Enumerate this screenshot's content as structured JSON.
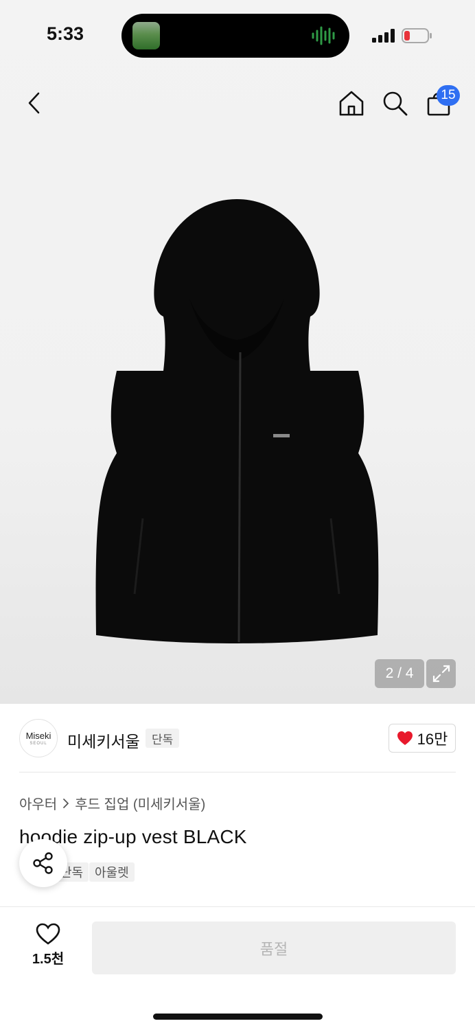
{
  "status_bar": {
    "time": "5:33"
  },
  "nav": {
    "cart_count": "15"
  },
  "gallery": {
    "counter": "2 / 4"
  },
  "brand": {
    "logo_text": "Miseki",
    "logo_subtext": "SEOUL",
    "name": "미세키서울",
    "tag": "단독",
    "likes": "16만"
  },
  "breadcrumb": {
    "category": "아우터",
    "subcategory": "후드 집업 (미세키서울)"
  },
  "product": {
    "title": "hoodie zip-up vest BLACK",
    "tags": [
      "단독",
      "아울렛"
    ]
  },
  "bottom_bar": {
    "wish_count": "1.5천",
    "soldout_label": "품절"
  },
  "colors": {
    "badge": "#2f6ff2",
    "heart": "#e8192c",
    "soldout_text": "#b5b5b5"
  }
}
